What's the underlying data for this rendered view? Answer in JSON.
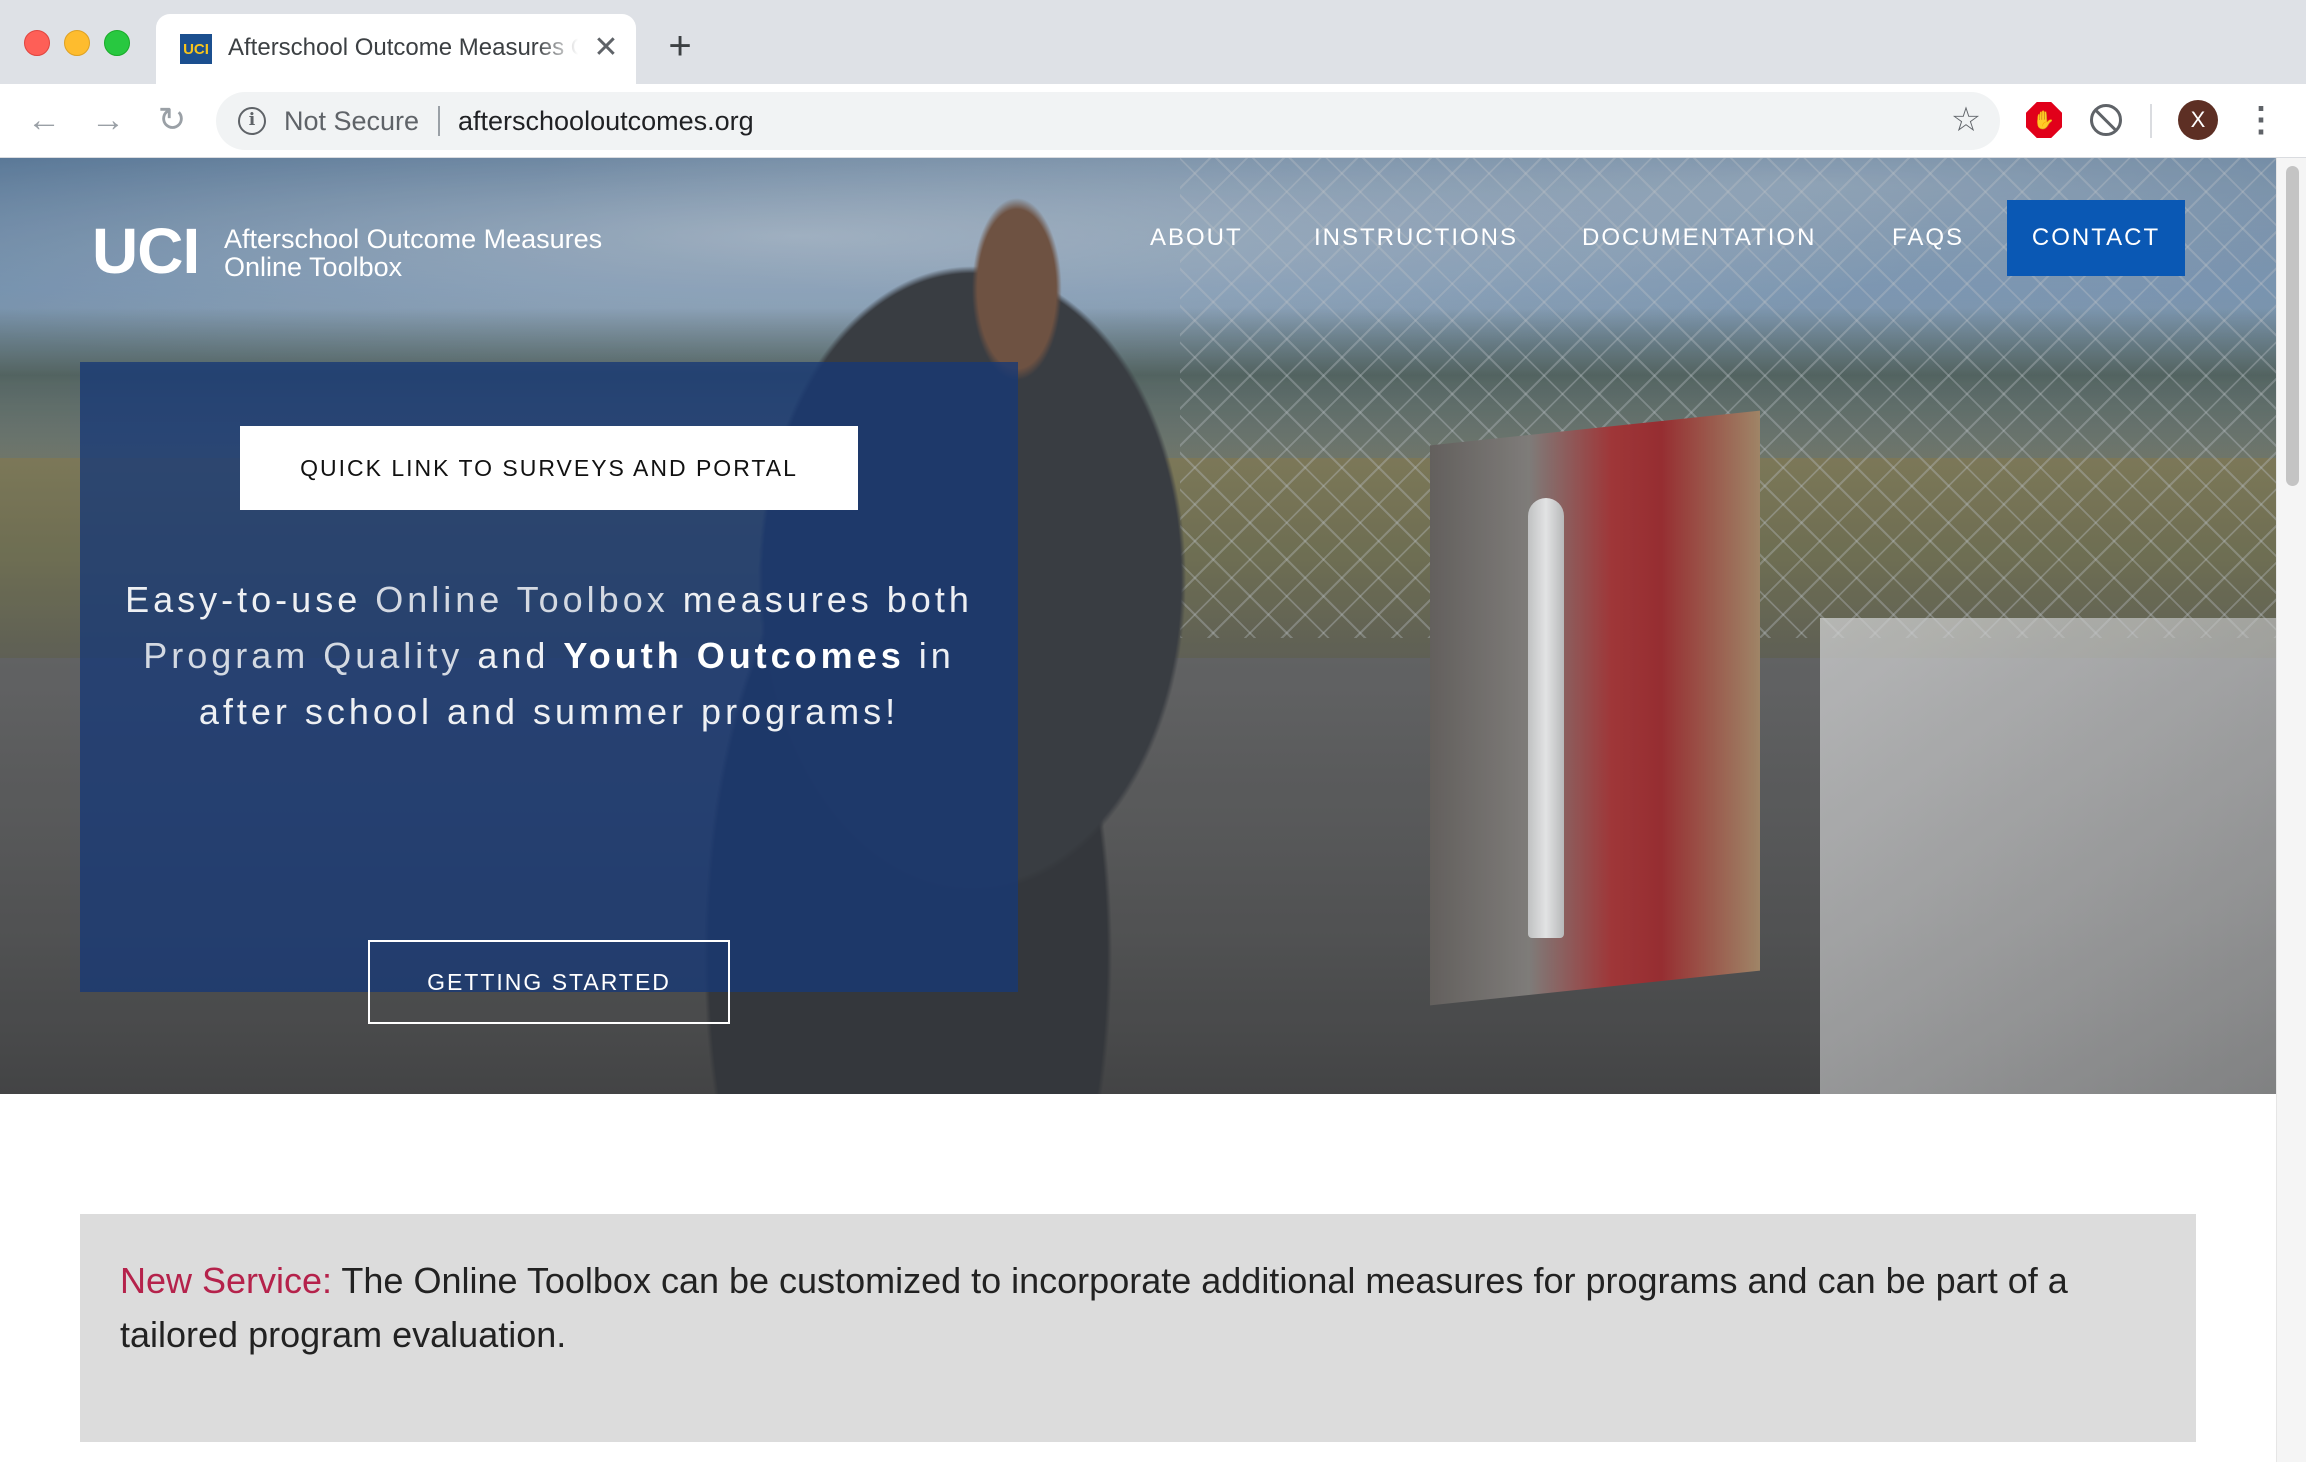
{
  "browser": {
    "tab": {
      "favicon_text": "UCI",
      "title": "Afterschool Outcome Measures Online Toolbox",
      "close_symbol": "✕"
    },
    "new_tab_symbol": "+",
    "nav": {
      "back": "←",
      "forward": "→",
      "reload": "↻"
    },
    "omnibox": {
      "security_text": "Not Secure",
      "url": "afterschooloutcomes.org"
    },
    "profile_initial": "X",
    "icons": {
      "info": "info-icon",
      "bookmark": "star-icon",
      "adblock": "stop-hand-icon",
      "blocker": "no-entry-icon",
      "menu": "kebab-menu-icon"
    },
    "colors": {
      "tabbar": "#dee1e6",
      "adblock": "#e1001a",
      "avatar": "#5d2f24"
    }
  },
  "site": {
    "logo": {
      "mark": "UCI",
      "line1": "Afterschool Outcome Measures",
      "line2": "Online Toolbox"
    },
    "nav": {
      "about": "ABOUT",
      "instructions": "INSTRUCTIONS",
      "documentation": "DOCUMENTATION",
      "faqs": "FAQS",
      "contact": "CONTACT"
    },
    "hero": {
      "quick_link": "QUICK LINK TO SURVEYS AND PORTAL",
      "tagline": {
        "p1": "Easy-to-use ",
        "p2": "Online Toolbox",
        "p3": " measures both",
        "p4": "Program Quality",
        "p5": " and ",
        "p6": "Youth Outcomes",
        "p7": " in",
        "p8": "after school and summer programs!"
      },
      "cta": "GETTING STARTED"
    },
    "announcement": {
      "label": "New Service:",
      "text": " The Online Toolbox can be customized to incorporate additional measures for programs and can be part of a tailored program evaluation."
    },
    "colors": {
      "accent": "#0a58b4",
      "panel": "#173976",
      "announcement_bg": "#dcdcdc",
      "announcement_label": "#b5224b"
    }
  }
}
